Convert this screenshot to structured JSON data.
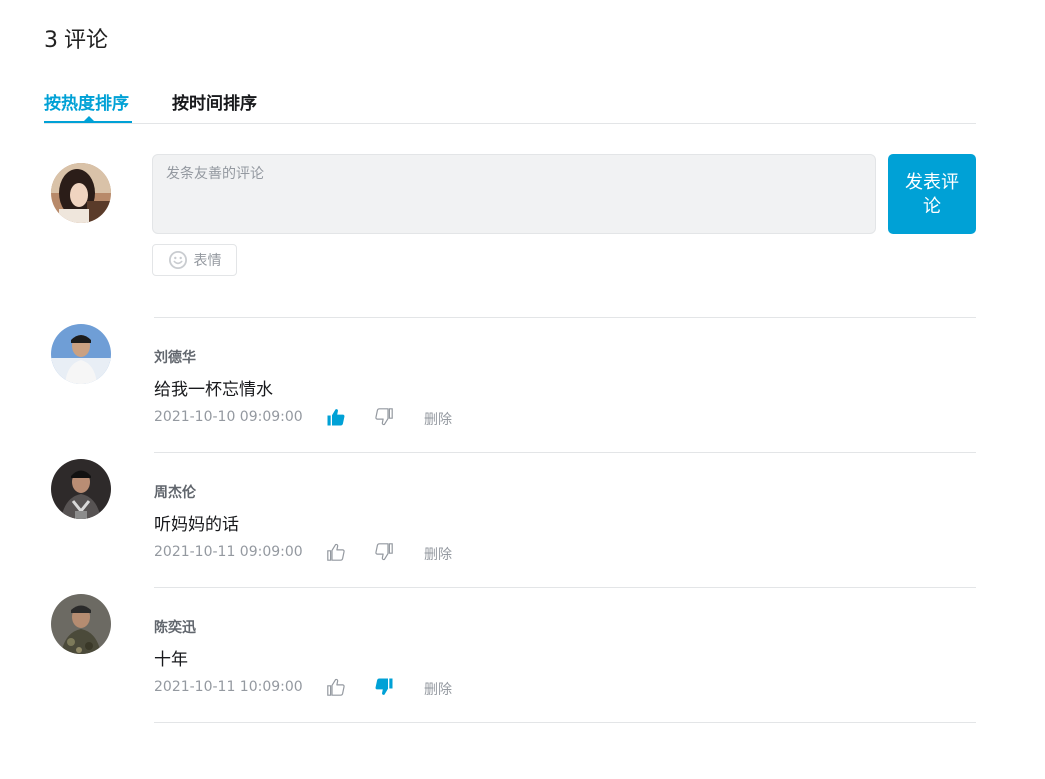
{
  "header": {
    "count": "3",
    "title": "评论"
  },
  "tabs": [
    {
      "label": "按热度排序",
      "active": true
    },
    {
      "label": "按时间排序",
      "active": false
    }
  ],
  "composer": {
    "placeholder": "发条友善的评论",
    "submit_label": "发表评论",
    "emoji_label": "表情"
  },
  "comments": [
    {
      "user": "刘德华",
      "content": "给我一杯忘情水",
      "time": "2021-10-10 09:09:00",
      "liked": true,
      "disliked": false,
      "delete_label": "删除"
    },
    {
      "user": "周杰伦",
      "content": "听妈妈的话",
      "time": "2021-10-11 09:09:00",
      "liked": false,
      "disliked": false,
      "delete_label": "删除"
    },
    {
      "user": "陈奕迅",
      "content": "十年",
      "time": "2021-10-11 10:09:00",
      "liked": false,
      "disliked": true,
      "delete_label": "删除"
    }
  ],
  "colors": {
    "accent": "#00a1d6",
    "muted": "#9499a0",
    "divider": "#e3e5e7"
  }
}
